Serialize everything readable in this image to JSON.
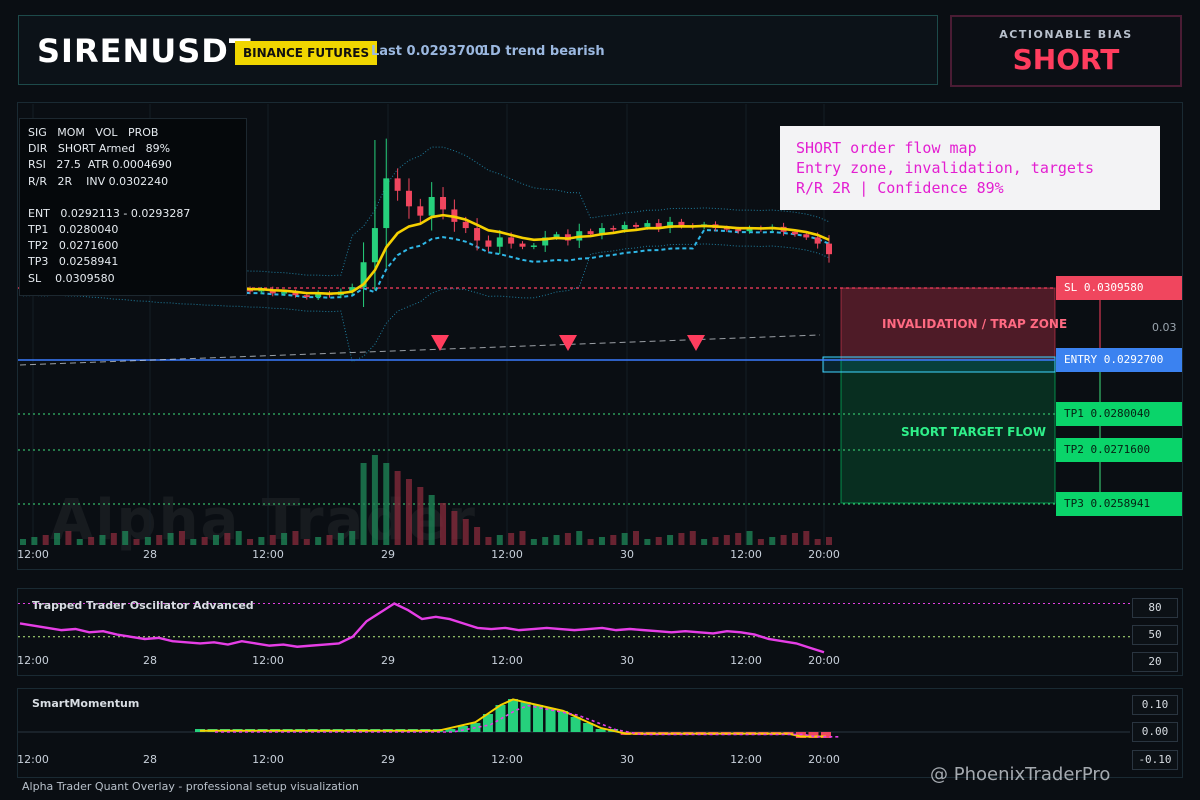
{
  "header": {
    "symbol": "SIRENUSDT",
    "exchange_badge": "BINANCE FUTURES",
    "last": "Last 0.0293700",
    "trend": "1D trend bearish"
  },
  "bias": {
    "label": "ACTIONABLE BIAS",
    "value": "SHORT"
  },
  "stats_table": {
    "rows": [
      "SIG   MOM   VOL   PROB",
      "DIR   SHORT Armed   89%",
      "RSI   27.5  ATR 0.0004690",
      "R/R   2R    INV 0.0302240",
      "",
      "ENT   0.0292113 - 0.0293287",
      "TP1   0.0280040",
      "TP2   0.0271600",
      "TP3   0.0258941",
      "SL    0.0309580"
    ]
  },
  "note": {
    "line1": "SHORT order flow map",
    "line2": "Entry zone, invalidation, targets",
    "line3": "R/R 2R | Confidence 89%"
  },
  "levels": {
    "sl": "SL 0.0309580",
    "entry": "ENTRY 0.0292700",
    "tp1": "TP1 0.0280040",
    "tp2": "TP2 0.0271600",
    "tp3": "TP3 0.0258941",
    "price_tick": "0.03"
  },
  "zones": {
    "invalidation": "INVALIDATION / TRAP ZONE",
    "target": "SHORT TARGET FLOW"
  },
  "time_axis": [
    "12:00",
    "28",
    "12:00",
    "29",
    "12:00",
    "30",
    "12:00",
    "20:00"
  ],
  "oscillator": {
    "title": "Trapped Trader Oscillator Advanced",
    "ticks": [
      "80",
      "50",
      "20"
    ]
  },
  "momentum": {
    "title": "SmartMomentum",
    "ticks": [
      "0.10",
      "0.00",
      "-0.10"
    ]
  },
  "footer": "Alpha Trader Quant Overlay - professional setup visualization",
  "watermark": "Alpha Trader",
  "credit": "@ PhoenixTraderPro",
  "colors": {
    "bull": "#26d07c",
    "bear": "#f0465e",
    "ema": "#f5d000",
    "sl": "#ff3d5e",
    "entry": "#2f7ff0",
    "tp": "#00d46a",
    "osc": "#e63ee6",
    "bias": "#ff3d5e"
  },
  "chart_data": [
    {
      "type": "candlestick",
      "series": [
        {
          "name": "",
          "values": [
            0.0293,
            0.02932,
            0.02928,
            0.02935,
            0.02926,
            0.02929,
            0.02922,
            0.02924,
            0.02918,
            0.02921,
            0.02916,
            0.02919,
            0.02913,
            0.02917,
            0.02912,
            0.02915,
            0.02911,
            0.02913,
            0.0291,
            0.02912,
            0.02908,
            0.02911,
            0.02905,
            0.02907,
            0.02902,
            0.02899,
            0.02905,
            0.02902,
            0.02908,
            0.02915,
            0.02955,
            0.0301,
            0.0309,
            0.0307,
            0.03045,
            0.0303,
            0.0306,
            0.0304,
            0.0302,
            0.0301,
            0.0299,
            0.0298,
            0.02995,
            0.02985,
            0.0298,
            0.02982,
            0.02995,
            0.03,
            0.0299,
            0.03005,
            0.03,
            0.0301,
            0.03008,
            0.03015,
            0.03012,
            0.03018,
            0.0301,
            0.0302,
            0.03014,
            0.03012,
            0.03016,
            0.0301,
            0.03008,
            0.03005,
            0.0301,
            0.03008,
            0.03012,
            0.03004,
            0.03,
            0.02995,
            0.02985,
            0.02968
          ]
        }
      ],
      "ylim": [
        0.025,
        0.032
      ]
    },
    {
      "type": "line",
      "series": [
        {
          "name": "",
          "values": [
            62,
            60,
            58,
            56,
            57,
            54,
            55,
            52,
            50,
            48,
            49,
            46,
            45,
            44,
            45,
            43,
            46,
            44,
            42,
            43,
            41,
            42,
            43,
            44,
            50,
            64,
            72,
            80,
            74,
            66,
            68,
            66,
            62,
            58,
            57,
            58,
            56,
            57,
            58,
            57,
            56,
            57,
            58,
            56,
            57,
            56,
            55,
            54,
            55,
            54,
            53,
            55,
            54,
            52,
            48,
            46,
            44,
            40,
            36
          ]
        }
      ],
      "ylim": [
        20,
        85
      ]
    },
    {
      "type": "bar",
      "series": [
        {
          "name": "",
          "values": [
            0.0,
            0.0,
            0.0,
            0.0,
            0.0,
            0.0,
            0.0,
            0.0,
            0.0,
            0.0,
            0.0,
            0.0,
            0.0,
            0.0,
            0.0,
            0.0,
            0.0,
            0.0,
            0.0,
            0.0,
            0.01,
            0.02,
            0.03,
            0.06,
            0.09,
            0.11,
            0.1,
            0.09,
            0.08,
            0.07,
            0.05,
            0.03,
            0.01,
            0.0,
            -0.01,
            -0.01,
            -0.01,
            -0.01,
            -0.01,
            -0.01,
            -0.01,
            -0.01,
            -0.01,
            -0.01,
            -0.01,
            -0.01,
            -0.01,
            -0.01,
            -0.02,
            -0.02,
            -0.02
          ]
        }
      ],
      "ylim": [
        -0.12,
        0.12
      ]
    }
  ]
}
